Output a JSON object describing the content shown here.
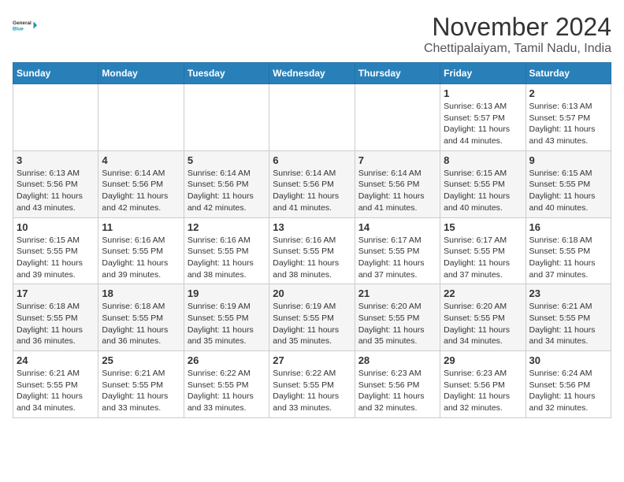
{
  "header": {
    "logo_line1": "General",
    "logo_line2": "Blue",
    "month": "November 2024",
    "location": "Chettipalaiyam, Tamil Nadu, India"
  },
  "weekdays": [
    "Sunday",
    "Monday",
    "Tuesday",
    "Wednesday",
    "Thursday",
    "Friday",
    "Saturday"
  ],
  "weeks": [
    [
      {
        "day": "",
        "info": ""
      },
      {
        "day": "",
        "info": ""
      },
      {
        "day": "",
        "info": ""
      },
      {
        "day": "",
        "info": ""
      },
      {
        "day": "",
        "info": ""
      },
      {
        "day": "1",
        "info": "Sunrise: 6:13 AM\nSunset: 5:57 PM\nDaylight: 11 hours\nand 44 minutes."
      },
      {
        "day": "2",
        "info": "Sunrise: 6:13 AM\nSunset: 5:57 PM\nDaylight: 11 hours\nand 43 minutes."
      }
    ],
    [
      {
        "day": "3",
        "info": "Sunrise: 6:13 AM\nSunset: 5:56 PM\nDaylight: 11 hours\nand 43 minutes."
      },
      {
        "day": "4",
        "info": "Sunrise: 6:14 AM\nSunset: 5:56 PM\nDaylight: 11 hours\nand 42 minutes."
      },
      {
        "day": "5",
        "info": "Sunrise: 6:14 AM\nSunset: 5:56 PM\nDaylight: 11 hours\nand 42 minutes."
      },
      {
        "day": "6",
        "info": "Sunrise: 6:14 AM\nSunset: 5:56 PM\nDaylight: 11 hours\nand 41 minutes."
      },
      {
        "day": "7",
        "info": "Sunrise: 6:14 AM\nSunset: 5:56 PM\nDaylight: 11 hours\nand 41 minutes."
      },
      {
        "day": "8",
        "info": "Sunrise: 6:15 AM\nSunset: 5:55 PM\nDaylight: 11 hours\nand 40 minutes."
      },
      {
        "day": "9",
        "info": "Sunrise: 6:15 AM\nSunset: 5:55 PM\nDaylight: 11 hours\nand 40 minutes."
      }
    ],
    [
      {
        "day": "10",
        "info": "Sunrise: 6:15 AM\nSunset: 5:55 PM\nDaylight: 11 hours\nand 39 minutes."
      },
      {
        "day": "11",
        "info": "Sunrise: 6:16 AM\nSunset: 5:55 PM\nDaylight: 11 hours\nand 39 minutes."
      },
      {
        "day": "12",
        "info": "Sunrise: 6:16 AM\nSunset: 5:55 PM\nDaylight: 11 hours\nand 38 minutes."
      },
      {
        "day": "13",
        "info": "Sunrise: 6:16 AM\nSunset: 5:55 PM\nDaylight: 11 hours\nand 38 minutes."
      },
      {
        "day": "14",
        "info": "Sunrise: 6:17 AM\nSunset: 5:55 PM\nDaylight: 11 hours\nand 37 minutes."
      },
      {
        "day": "15",
        "info": "Sunrise: 6:17 AM\nSunset: 5:55 PM\nDaylight: 11 hours\nand 37 minutes."
      },
      {
        "day": "16",
        "info": "Sunrise: 6:18 AM\nSunset: 5:55 PM\nDaylight: 11 hours\nand 37 minutes."
      }
    ],
    [
      {
        "day": "17",
        "info": "Sunrise: 6:18 AM\nSunset: 5:55 PM\nDaylight: 11 hours\nand 36 minutes."
      },
      {
        "day": "18",
        "info": "Sunrise: 6:18 AM\nSunset: 5:55 PM\nDaylight: 11 hours\nand 36 minutes."
      },
      {
        "day": "19",
        "info": "Sunrise: 6:19 AM\nSunset: 5:55 PM\nDaylight: 11 hours\nand 35 minutes."
      },
      {
        "day": "20",
        "info": "Sunrise: 6:19 AM\nSunset: 5:55 PM\nDaylight: 11 hours\nand 35 minutes."
      },
      {
        "day": "21",
        "info": "Sunrise: 6:20 AM\nSunset: 5:55 PM\nDaylight: 11 hours\nand 35 minutes."
      },
      {
        "day": "22",
        "info": "Sunrise: 6:20 AM\nSunset: 5:55 PM\nDaylight: 11 hours\nand 34 minutes."
      },
      {
        "day": "23",
        "info": "Sunrise: 6:21 AM\nSunset: 5:55 PM\nDaylight: 11 hours\nand 34 minutes."
      }
    ],
    [
      {
        "day": "24",
        "info": "Sunrise: 6:21 AM\nSunset: 5:55 PM\nDaylight: 11 hours\nand 34 minutes."
      },
      {
        "day": "25",
        "info": "Sunrise: 6:21 AM\nSunset: 5:55 PM\nDaylight: 11 hours\nand 33 minutes."
      },
      {
        "day": "26",
        "info": "Sunrise: 6:22 AM\nSunset: 5:55 PM\nDaylight: 11 hours\nand 33 minutes."
      },
      {
        "day": "27",
        "info": "Sunrise: 6:22 AM\nSunset: 5:55 PM\nDaylight: 11 hours\nand 33 minutes."
      },
      {
        "day": "28",
        "info": "Sunrise: 6:23 AM\nSunset: 5:56 PM\nDaylight: 11 hours\nand 32 minutes."
      },
      {
        "day": "29",
        "info": "Sunrise: 6:23 AM\nSunset: 5:56 PM\nDaylight: 11 hours\nand 32 minutes."
      },
      {
        "day": "30",
        "info": "Sunrise: 6:24 AM\nSunset: 5:56 PM\nDaylight: 11 hours\nand 32 minutes."
      }
    ]
  ]
}
